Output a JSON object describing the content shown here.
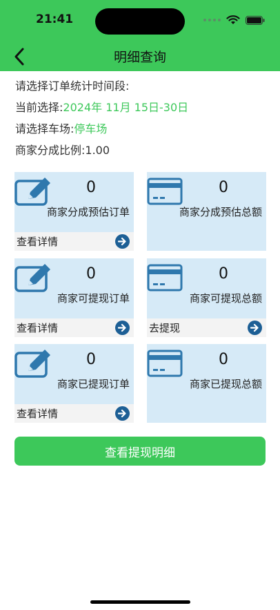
{
  "status_bar": {
    "time": "21:41"
  },
  "nav": {
    "title": "明细查询",
    "back_icon": "chevron-left-icon"
  },
  "info": {
    "period_label": "请选择订单统计时间段:",
    "current_label": "当前选择:",
    "current_value": "2024年 11月 15日-30日",
    "parking_label": "请选择车场:",
    "parking_value": "停车场",
    "ratio_label": "商家分成比例:",
    "ratio_value": "1.00"
  },
  "cards": {
    "est_orders": {
      "count": "0",
      "caption": "商家分成预估订单",
      "footer": "查看详情"
    },
    "est_amount": {
      "count": "0",
      "caption": "商家分成预估总额"
    },
    "withdrawable_orders": {
      "count": "0",
      "caption": "商家可提现订单",
      "footer": "查看详情"
    },
    "withdrawable_amount": {
      "count": "0",
      "caption": "商家可提现总额",
      "footer": "去提现"
    },
    "withdrawn_orders": {
      "count": "0",
      "caption": "商家已提现订单",
      "footer": "查看详情"
    },
    "withdrawn_amount": {
      "count": "0",
      "caption": "商家已提现总额"
    }
  },
  "main_button": {
    "label": "查看提现明细"
  },
  "colors": {
    "brand_green": "#3dc85a",
    "card_bg": "#d6eaf7",
    "icon_blue": "#2f78ad",
    "arrow_blue": "#1d5f95"
  }
}
